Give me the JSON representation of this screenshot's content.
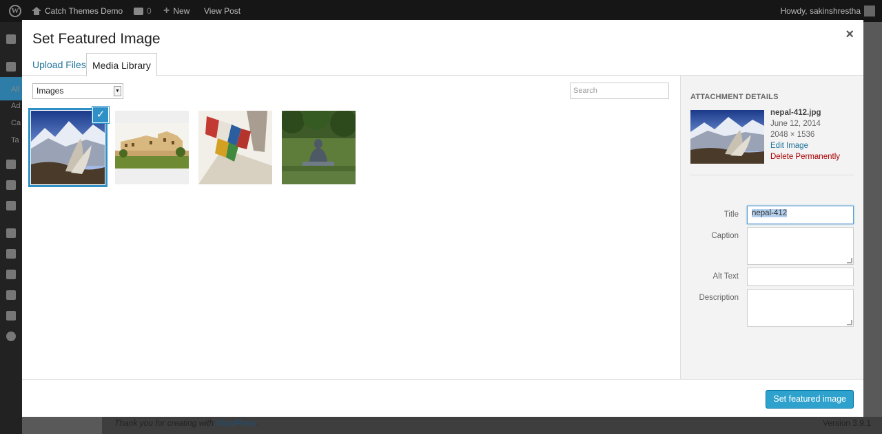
{
  "admin_bar": {
    "site_name": "Catch Themes Demo",
    "comments_count": "0",
    "new_label": "New",
    "view_post_label": "View Post",
    "greeting": "Howdy, sakinshrestha"
  },
  "admin_menu": {
    "labels": [
      "All",
      "Ad",
      "Ca",
      "Ta"
    ]
  },
  "footer": {
    "thank_you_prefix": "Thank you for creating with ",
    "thank_you_link": "WordPress",
    "thank_you_suffix": ".",
    "version": "Version 3.9.1"
  },
  "modal": {
    "title": "Set Featured Image",
    "close_icon": "×",
    "tabs": [
      {
        "label": "Upload Files",
        "active": false
      },
      {
        "label": "Media Library",
        "active": true
      }
    ],
    "filter": {
      "selected": "Images"
    },
    "search": {
      "placeholder": "Search",
      "value": ""
    },
    "attachments": [
      {
        "name": "nepal-412",
        "selected": true
      },
      {
        "name": "resort",
        "selected": false
      },
      {
        "name": "prayer-flags",
        "selected": false
      },
      {
        "name": "buddha-statue",
        "selected": false
      }
    ],
    "details": {
      "heading": "ATTACHMENT DETAILS",
      "filename": "nepal-412.jpg",
      "date": "June 12, 2014",
      "dimensions": "2048 × 1536",
      "edit_label": "Edit Image",
      "delete_label": "Delete Permanently",
      "fields": {
        "title_label": "Title",
        "title_value": "nepal-412",
        "caption_label": "Caption",
        "caption_value": "",
        "alt_label": "Alt Text",
        "alt_value": "",
        "description_label": "Description",
        "description_value": ""
      }
    },
    "primary_button": "Set featured image",
    "colors": {
      "accent": "#2ea2cc",
      "selection": "#2e90c7",
      "link": "#21759b",
      "danger": "#aa0000"
    }
  }
}
